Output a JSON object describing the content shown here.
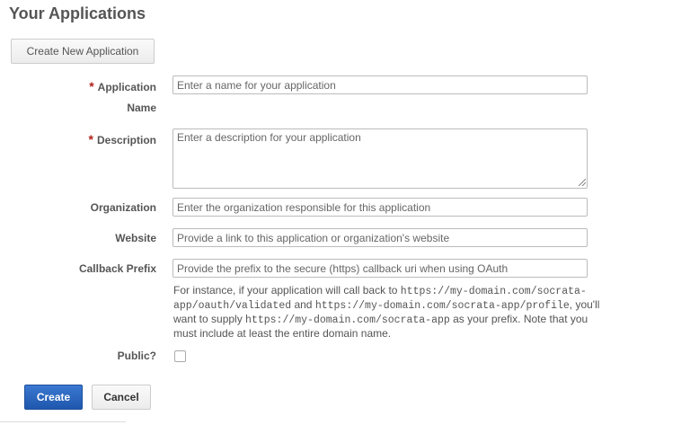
{
  "header": {
    "title": "Your Applications"
  },
  "toolbar": {
    "create_new_label": "Create New Application"
  },
  "form": {
    "required_marker": "*",
    "application_name": {
      "label_line1": "Application",
      "label_line2": "Name",
      "placeholder": "Enter a name for your application",
      "value": ""
    },
    "description": {
      "label": "Description",
      "placeholder": "Enter a description for your application",
      "value": ""
    },
    "organization": {
      "label": "Organization",
      "placeholder": "Enter the organization responsible for this application",
      "value": ""
    },
    "website": {
      "label": "Website",
      "placeholder": "Provide a link to this application or organization's website",
      "value": ""
    },
    "callback_prefix": {
      "label": "Callback Prefix",
      "placeholder": "Provide the prefix to the secure (https) callback uri when using OAuth",
      "value": "",
      "help": {
        "part1": "For instance, if your application will call back to ",
        "code1": "https://my-domain.com/socrata-app/oauth/validated",
        "part2": " and ",
        "code2": "https://my-domain.com/socrata-app/profile",
        "part3": ", you'll want to supply ",
        "code3": "https://my-domain.com/socrata-app",
        "part4": " as your prefix. Note that you must include at least the entire domain name."
      }
    },
    "public": {
      "label": "Public?",
      "checked": false
    }
  },
  "actions": {
    "create_label": "Create",
    "cancel_label": "Cancel"
  },
  "colors": {
    "primary": "#1e57ad",
    "required": "#b0221b",
    "label": "#555555"
  }
}
